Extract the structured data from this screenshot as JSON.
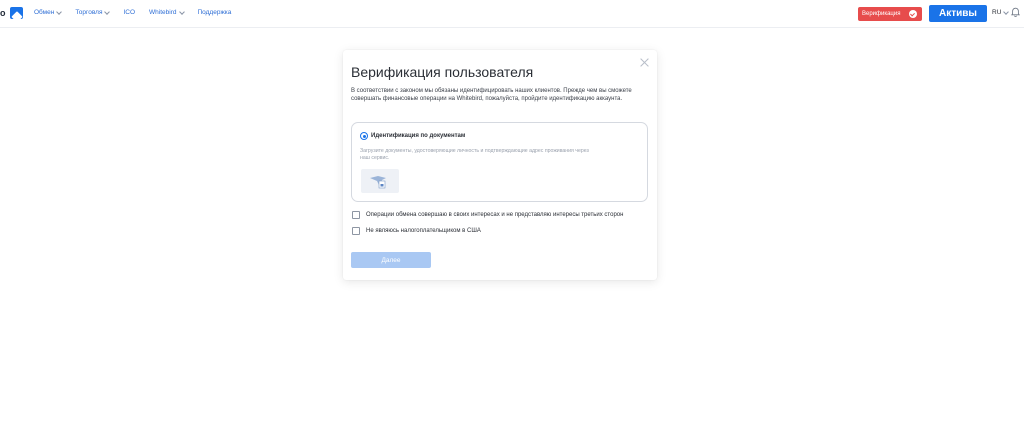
{
  "header": {
    "logo_text": "o",
    "nav": [
      {
        "label": "Обмен",
        "dropdown": true
      },
      {
        "label": "Торговля",
        "dropdown": true
      },
      {
        "label": "ICO",
        "dropdown": false
      },
      {
        "label": "Whitebird",
        "dropdown": true
      },
      {
        "label": "Поддержка",
        "dropdown": false
      }
    ],
    "verify_label": "Верификация",
    "assets_label": "Активы",
    "language": "RU"
  },
  "modal": {
    "title": "Верификация пользователя",
    "description": "В соответствии с законом мы обязаны идентифицировать наших клиентов. Прежде чем вы сможете совершать финансовые операции на Whitebird, пожалуйста, пройдите идентификацию аккаунта.",
    "option": {
      "label": "Идентификация по документам",
      "hint": "Загрузите документы, удостоверяющие личность и подтверждающие адрес проживания через наш сервис.",
      "selected": true
    },
    "checkboxes": [
      {
        "label": "Операции обмена совершаю в своих интересах и не представляю интересы третьих сторон",
        "checked": false
      },
      {
        "label": "Не являюсь налогоплательщиком в США",
        "checked": false
      }
    ],
    "next_label": "Далее"
  },
  "colors": {
    "accent": "#1a73e8",
    "danger": "#e74c4c",
    "disabled_button": "#a9c8f3"
  }
}
